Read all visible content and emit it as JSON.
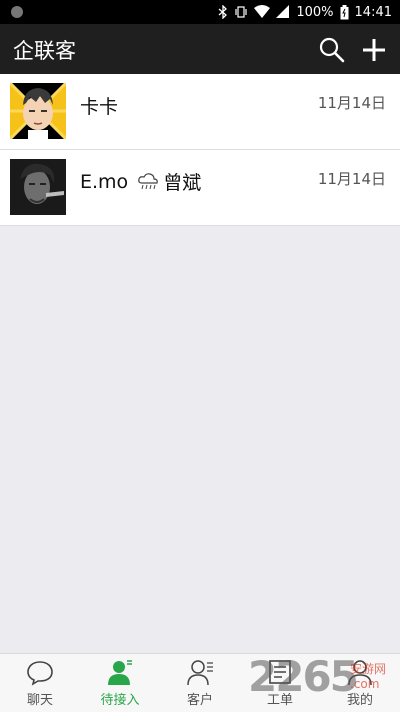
{
  "status_bar": {
    "battery": "100%",
    "time": "14:41",
    "icons": [
      "bluetooth-icon",
      "vibrate-icon",
      "wifi-icon",
      "signal-icon",
      "battery-icon"
    ]
  },
  "app_bar": {
    "title": "企联客",
    "actions": [
      "search-icon",
      "add-icon"
    ]
  },
  "conversations": [
    {
      "name": "卡卡",
      "date": "11月14日",
      "avatar": "cartoon-avatar"
    },
    {
      "name": "E.mo",
      "name_suffix": "曾斌",
      "date": "11月14日",
      "avatar": "photo-avatar",
      "weather_icon": "rain-cloud-icon"
    }
  ],
  "tabs": [
    {
      "label": "聊天",
      "icon": "chat-bubble-icon",
      "active": false
    },
    {
      "label": "待接入",
      "icon": "pending-user-icon",
      "active": true
    },
    {
      "label": "客户",
      "icon": "customer-icon",
      "active": false
    },
    {
      "label": "工单",
      "icon": "ticket-icon",
      "active": false
    },
    {
      "label": "我的",
      "icon": "profile-icon",
      "active": false
    }
  ],
  "watermark": {
    "text_left": "2265",
    "text_right": "安游网",
    "domain": ".com"
  },
  "colors": {
    "active_tab": "#2aa64a",
    "appbar_bg": "#1f1f1f",
    "page_bg": "#ececf0"
  }
}
